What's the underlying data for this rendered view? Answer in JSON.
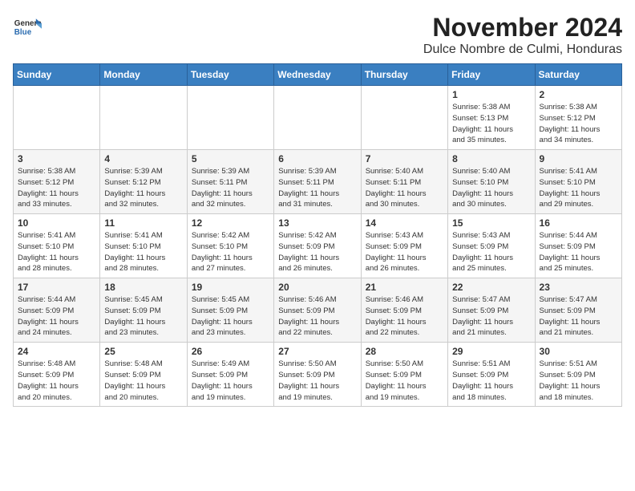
{
  "logo": {
    "general": "General",
    "blue": "Blue"
  },
  "header": {
    "month": "November 2024",
    "location": "Dulce Nombre de Culmi, Honduras"
  },
  "weekdays": [
    "Sunday",
    "Monday",
    "Tuesday",
    "Wednesday",
    "Thursday",
    "Friday",
    "Saturday"
  ],
  "weeks": [
    [
      {
        "day": "",
        "info": ""
      },
      {
        "day": "",
        "info": ""
      },
      {
        "day": "",
        "info": ""
      },
      {
        "day": "",
        "info": ""
      },
      {
        "day": "",
        "info": ""
      },
      {
        "day": "1",
        "info": "Sunrise: 5:38 AM\nSunset: 5:13 PM\nDaylight: 11 hours\nand 35 minutes."
      },
      {
        "day": "2",
        "info": "Sunrise: 5:38 AM\nSunset: 5:12 PM\nDaylight: 11 hours\nand 34 minutes."
      }
    ],
    [
      {
        "day": "3",
        "info": "Sunrise: 5:38 AM\nSunset: 5:12 PM\nDaylight: 11 hours\nand 33 minutes."
      },
      {
        "day": "4",
        "info": "Sunrise: 5:39 AM\nSunset: 5:12 PM\nDaylight: 11 hours\nand 32 minutes."
      },
      {
        "day": "5",
        "info": "Sunrise: 5:39 AM\nSunset: 5:11 PM\nDaylight: 11 hours\nand 32 minutes."
      },
      {
        "day": "6",
        "info": "Sunrise: 5:39 AM\nSunset: 5:11 PM\nDaylight: 11 hours\nand 31 minutes."
      },
      {
        "day": "7",
        "info": "Sunrise: 5:40 AM\nSunset: 5:11 PM\nDaylight: 11 hours\nand 30 minutes."
      },
      {
        "day": "8",
        "info": "Sunrise: 5:40 AM\nSunset: 5:10 PM\nDaylight: 11 hours\nand 30 minutes."
      },
      {
        "day": "9",
        "info": "Sunrise: 5:41 AM\nSunset: 5:10 PM\nDaylight: 11 hours\nand 29 minutes."
      }
    ],
    [
      {
        "day": "10",
        "info": "Sunrise: 5:41 AM\nSunset: 5:10 PM\nDaylight: 11 hours\nand 28 minutes."
      },
      {
        "day": "11",
        "info": "Sunrise: 5:41 AM\nSunset: 5:10 PM\nDaylight: 11 hours\nand 28 minutes."
      },
      {
        "day": "12",
        "info": "Sunrise: 5:42 AM\nSunset: 5:10 PM\nDaylight: 11 hours\nand 27 minutes."
      },
      {
        "day": "13",
        "info": "Sunrise: 5:42 AM\nSunset: 5:09 PM\nDaylight: 11 hours\nand 26 minutes."
      },
      {
        "day": "14",
        "info": "Sunrise: 5:43 AM\nSunset: 5:09 PM\nDaylight: 11 hours\nand 26 minutes."
      },
      {
        "day": "15",
        "info": "Sunrise: 5:43 AM\nSunset: 5:09 PM\nDaylight: 11 hours\nand 25 minutes."
      },
      {
        "day": "16",
        "info": "Sunrise: 5:44 AM\nSunset: 5:09 PM\nDaylight: 11 hours\nand 25 minutes."
      }
    ],
    [
      {
        "day": "17",
        "info": "Sunrise: 5:44 AM\nSunset: 5:09 PM\nDaylight: 11 hours\nand 24 minutes."
      },
      {
        "day": "18",
        "info": "Sunrise: 5:45 AM\nSunset: 5:09 PM\nDaylight: 11 hours\nand 23 minutes."
      },
      {
        "day": "19",
        "info": "Sunrise: 5:45 AM\nSunset: 5:09 PM\nDaylight: 11 hours\nand 23 minutes."
      },
      {
        "day": "20",
        "info": "Sunrise: 5:46 AM\nSunset: 5:09 PM\nDaylight: 11 hours\nand 22 minutes."
      },
      {
        "day": "21",
        "info": "Sunrise: 5:46 AM\nSunset: 5:09 PM\nDaylight: 11 hours\nand 22 minutes."
      },
      {
        "day": "22",
        "info": "Sunrise: 5:47 AM\nSunset: 5:09 PM\nDaylight: 11 hours\nand 21 minutes."
      },
      {
        "day": "23",
        "info": "Sunrise: 5:47 AM\nSunset: 5:09 PM\nDaylight: 11 hours\nand 21 minutes."
      }
    ],
    [
      {
        "day": "24",
        "info": "Sunrise: 5:48 AM\nSunset: 5:09 PM\nDaylight: 11 hours\nand 20 minutes."
      },
      {
        "day": "25",
        "info": "Sunrise: 5:48 AM\nSunset: 5:09 PM\nDaylight: 11 hours\nand 20 minutes."
      },
      {
        "day": "26",
        "info": "Sunrise: 5:49 AM\nSunset: 5:09 PM\nDaylight: 11 hours\nand 19 minutes."
      },
      {
        "day": "27",
        "info": "Sunrise: 5:50 AM\nSunset: 5:09 PM\nDaylight: 11 hours\nand 19 minutes."
      },
      {
        "day": "28",
        "info": "Sunrise: 5:50 AM\nSunset: 5:09 PM\nDaylight: 11 hours\nand 19 minutes."
      },
      {
        "day": "29",
        "info": "Sunrise: 5:51 AM\nSunset: 5:09 PM\nDaylight: 11 hours\nand 18 minutes."
      },
      {
        "day": "30",
        "info": "Sunrise: 5:51 AM\nSunset: 5:09 PM\nDaylight: 11 hours\nand 18 minutes."
      }
    ]
  ]
}
